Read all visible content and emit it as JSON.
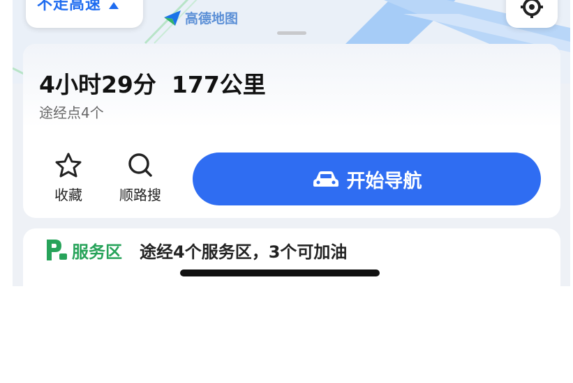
{
  "route_option": {
    "label": "不走高速"
  },
  "map": {
    "logo_text": "高德地图"
  },
  "summary": {
    "duration": "4小时29分",
    "distance": "177公里",
    "via_points": "途经点4个"
  },
  "actions": {
    "favorite_label": "收藏",
    "search_along_label": "顺路搜",
    "start_nav_label": "开始导航"
  },
  "service_area": {
    "title": "服务区",
    "description": "途经4个服务区，3个可加油"
  },
  "colors": {
    "accent_blue": "#2f6df2",
    "service_green": "#27a35a"
  }
}
